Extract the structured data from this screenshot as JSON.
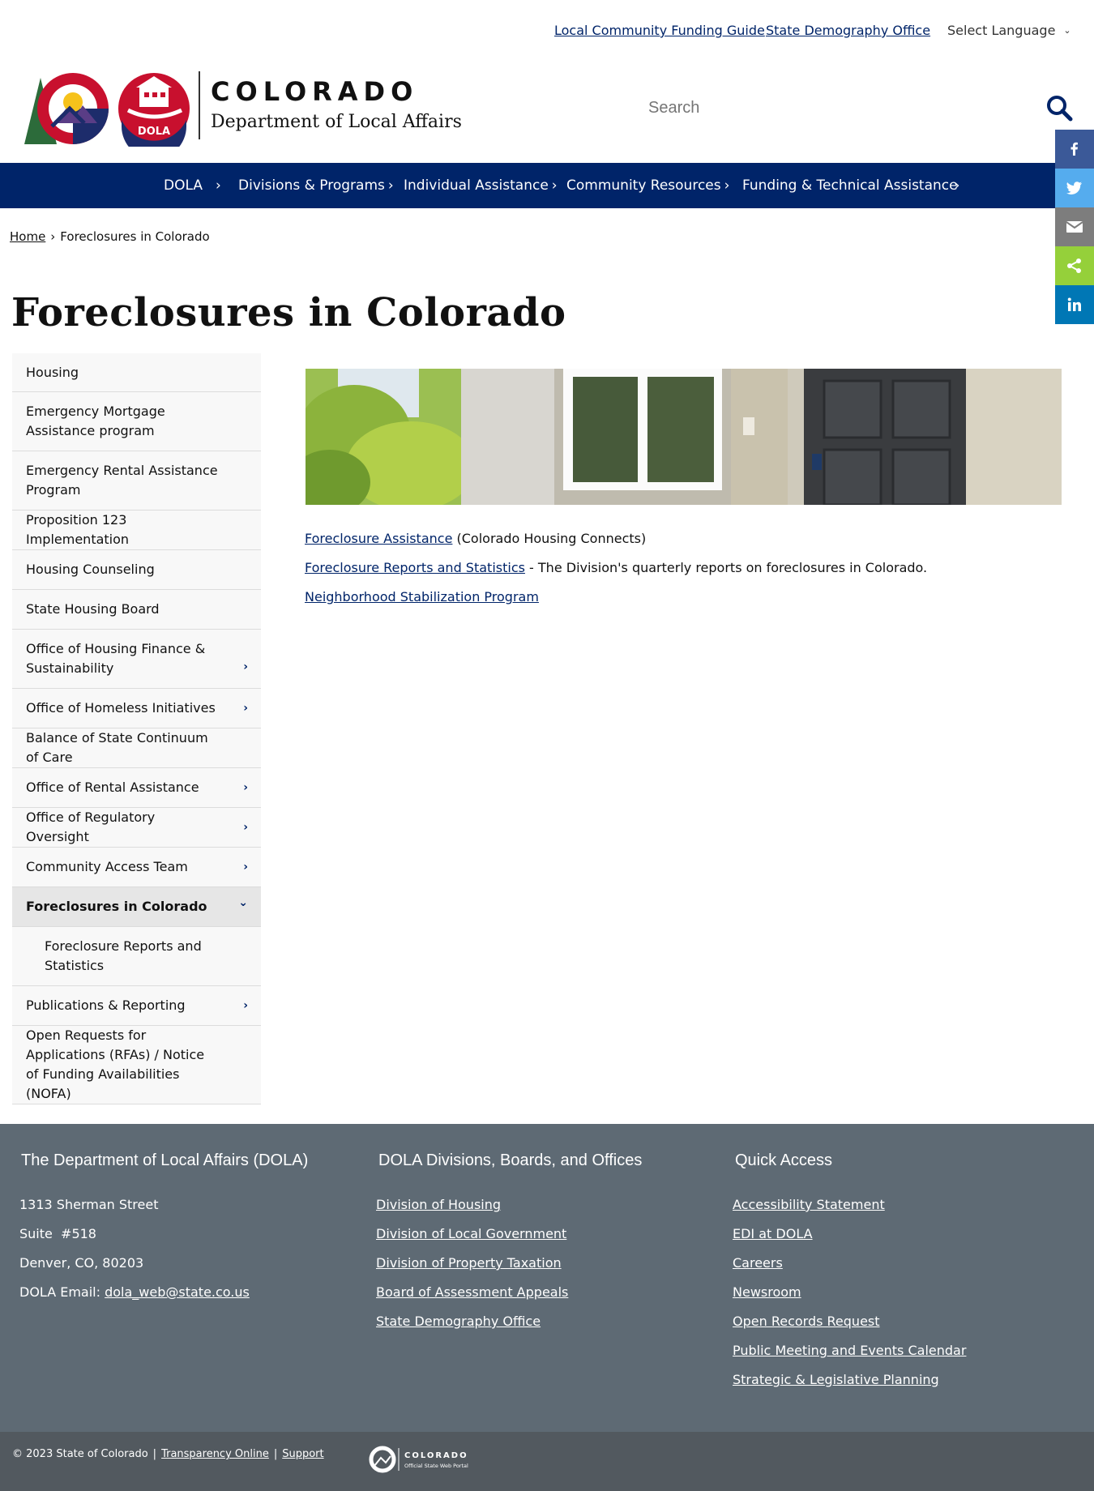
{
  "utility": {
    "links": [
      "Local Community Funding Guide",
      "State Demography Office"
    ],
    "language": "Select Language"
  },
  "header": {
    "brand_title": "COLORADO",
    "brand_subtitle": "Department of Local Affairs",
    "logo_text": "DOLA",
    "search_placeholder": "Search"
  },
  "nav": {
    "items": [
      "DOLA",
      "Divisions & Programs",
      "Individual Assistance",
      "Community Resources",
      "Funding & Technical Assistance"
    ]
  },
  "share": {
    "colors": {
      "facebook": "#3b5998",
      "twitter": "#55acee",
      "email": "#7d7d7d",
      "sharethis": "#95d03a",
      "linkedin": "#0077b5"
    }
  },
  "breadcrumb": {
    "home": "Home",
    "separator": "›",
    "current": "Foreclosures in Colorado"
  },
  "page_title": "Foreclosures in Colorado",
  "sidebar": {
    "items": [
      {
        "label": "Housing",
        "arrow": ""
      },
      {
        "label": "Emergency Mortgage Assistance program",
        "arrow": ""
      },
      {
        "label": "Emergency Rental Assistance Program",
        "arrow": ""
      },
      {
        "label": "Proposition 123 Implementation",
        "arrow": ""
      },
      {
        "label": "Housing Counseling",
        "arrow": ""
      },
      {
        "label": "State Housing Board",
        "arrow": ""
      },
      {
        "label": "Office of Housing Finance & Sustainability",
        "arrow": "›"
      },
      {
        "label": "Office of Homeless Initiatives",
        "arrow": "›"
      },
      {
        "label": "Balance of State Continuum of Care",
        "arrow": ""
      },
      {
        "label": "Office of Rental Assistance",
        "arrow": "›"
      },
      {
        "label": "Office of Regulatory Oversight",
        "arrow": "›"
      },
      {
        "label": "Community Access Team",
        "arrow": "›"
      },
      {
        "label": "Foreclosures in Colorado",
        "arrow": "⌄"
      },
      {
        "label": "Foreclosure Reports and Statistics",
        "arrow": ""
      },
      {
        "label": "Publications & Reporting",
        "arrow": "›"
      },
      {
        "label": "Open Requests for Applications (RFAs) / Notice of Funding Availabilities (NOFA)",
        "arrow": ""
      }
    ]
  },
  "content": {
    "line1": {
      "link": "Foreclosure Assistance",
      "text": " (Colorado Housing Connects)"
    },
    "line2": {
      "link": "Foreclosure Reports and Statistics",
      "text": " - The Division's quarterly reports on foreclosures in Colorado."
    },
    "line3": {
      "link": "Neighborhood Stabilization Program",
      "text": ""
    }
  },
  "footer": {
    "col1": {
      "title": "The Department of Local Affairs (DOLA)",
      "address1": "1313 Sherman Street",
      "address2": "Suite  #518",
      "address3": "Denver, CO, 80203",
      "email_label": "DOLA Email: ",
      "email": "dola_web@state.co.us"
    },
    "col2": {
      "title": "DOLA Divisions, Boards, and Offices",
      "links": [
        "Division of Housing",
        "Division of Local Government",
        "Division of Property Taxation",
        "Board of Assessment Appeals",
        "State Demography Office"
      ]
    },
    "col3": {
      "title": "Quick Access",
      "links": [
        "Accessibility Statement",
        "EDI at DOLA",
        "Careers",
        "Newsroom",
        "Open Records Request",
        "Public Meeting and Events Calendar",
        "Strategic & Legislative Planning"
      ]
    }
  },
  "subfooter": {
    "copyright": "© 2023 State of Colorado",
    "separator": "|",
    "links": [
      "Transparency Online",
      "Support"
    ],
    "portal_title": "COLORADO",
    "portal_subtitle": "Official State Web Portal"
  }
}
